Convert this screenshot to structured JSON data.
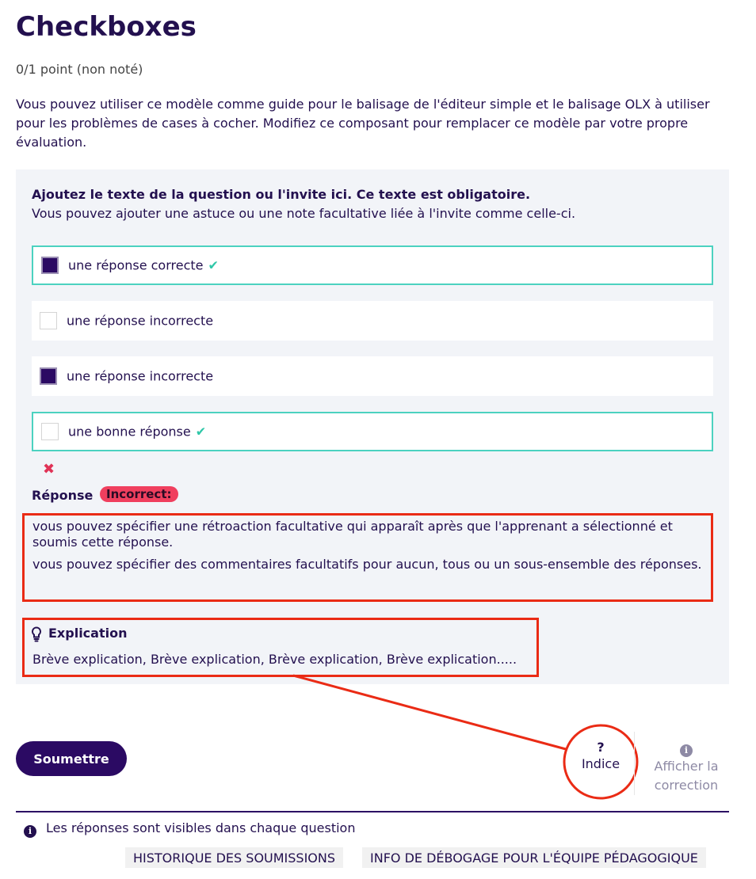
{
  "header": {
    "title": "Checkboxes",
    "points": "0/1 point (non noté)",
    "intro": "Vous pouvez utiliser ce modèle comme guide pour le balisage de l'éditeur simple et le balisage OLX à utiliser pour les problèmes de cases à cocher. Modifiez ce composant pour remplacer ce modèle par votre propre évaluation."
  },
  "problem": {
    "question": "Ajoutez le texte de la question ou l'invite ici. Ce texte est obligatoire.",
    "hint_note": "Vous pouvez ajouter une astuce ou une note facultative liée à l'invite comme celle-ci.",
    "choices": [
      {
        "label": "une réponse correcte",
        "checked": true,
        "correct": true
      },
      {
        "label": "une réponse incorrecte",
        "checked": false,
        "correct": false
      },
      {
        "label": "une réponse incorrecte",
        "checked": true,
        "correct": false
      },
      {
        "label": "une bonne réponse",
        "checked": false,
        "correct": true
      }
    ],
    "response_label": "Réponse",
    "status_badge": "Incorrect:",
    "feedback": [
      "vous pouvez spécifier une rétroaction facultative qui apparaît après que l'apprenant a sélectionné et soumis cette réponse.",
      "vous pouvez spécifier des commentaires facultatifs pour aucun, tous ou un sous-ensemble des réponses."
    ],
    "explanation_title": "Explication",
    "explanation_text": "Brève explication, Brève explication, Brève explication, Brève explication....."
  },
  "actions": {
    "submit": "Soumettre",
    "hint_symbol": "?",
    "hint": "Indice",
    "show_answer": "Afficher la correction"
  },
  "footer": {
    "notice": "Les réponses sont visibles dans chaque question",
    "history": "HISTORIQUE DES SOUMISSIONS",
    "debug": "INFO DE DÉBOGAGE POUR L'ÉQUIPE PÉDAGOGIQUE"
  },
  "colors": {
    "primary": "#2b0a63",
    "correct": "#4cd2c0",
    "incorrect": "#f03f5e",
    "annotation": "#ea2b15"
  },
  "icons": {
    "checkmark": "check-icon",
    "error": "x-icon",
    "explanation": "lightbulb-icon",
    "info": "info-icon"
  }
}
